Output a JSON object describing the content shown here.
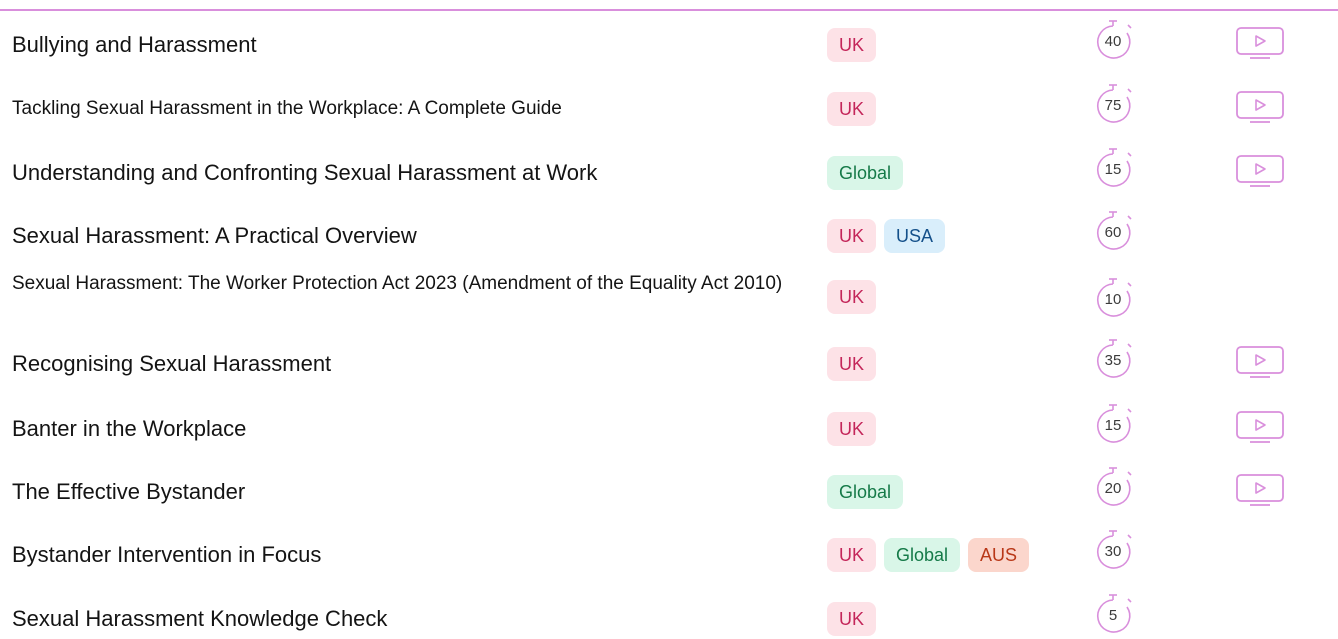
{
  "rows": [
    {
      "title": "Bullying and Harassment",
      "tags": [
        "UK"
      ],
      "minutes": "40",
      "video": true
    },
    {
      "title": "Tackling Sexual Harassment in the Workplace: A Complete Guide",
      "tags": [
        "UK"
      ],
      "minutes": "75",
      "video": true
    },
    {
      "title": "Understanding and Confronting Sexual Harassment at Work",
      "tags": [
        "Global"
      ],
      "minutes": "15",
      "video": true
    },
    {
      "title": "Sexual Harassment: A Practical Overview",
      "tags": [
        "UK",
        "USA"
      ],
      "minutes": "60",
      "video": false
    },
    {
      "title": "Sexual Harassment: The Worker Protection Act 2023 (Amendment of the Equality Act 2010)",
      "tags": [
        "UK"
      ],
      "minutes": "10",
      "video": false
    },
    {
      "title": "Recognising Sexual Harassment",
      "tags": [
        "UK"
      ],
      "minutes": "35",
      "video": true
    },
    {
      "title": "Banter in the Workplace",
      "tags": [
        "UK"
      ],
      "minutes": "15",
      "video": true
    },
    {
      "title": "The Effective Bystander",
      "tags": [
        "Global"
      ],
      "minutes": "20",
      "video": true
    },
    {
      "title": "Bystander Intervention in Focus",
      "tags": [
        "UK",
        "Global",
        "AUS"
      ],
      "minutes": "30",
      "video": false
    },
    {
      "title": "Sexual Harassment Knowledge Check",
      "tags": [
        "UK"
      ],
      "minutes": "5",
      "video": false
    }
  ],
  "icons": {
    "timer": "stopwatch-icon",
    "video": "video-play-icon"
  },
  "colors": {
    "accent": "#d98fdc",
    "tag_uk_bg": "#fde2e7",
    "tag_global_bg": "#d9f6e8",
    "tag_usa_bg": "#d9eefb",
    "tag_aus_bg": "#fbd6cc"
  }
}
